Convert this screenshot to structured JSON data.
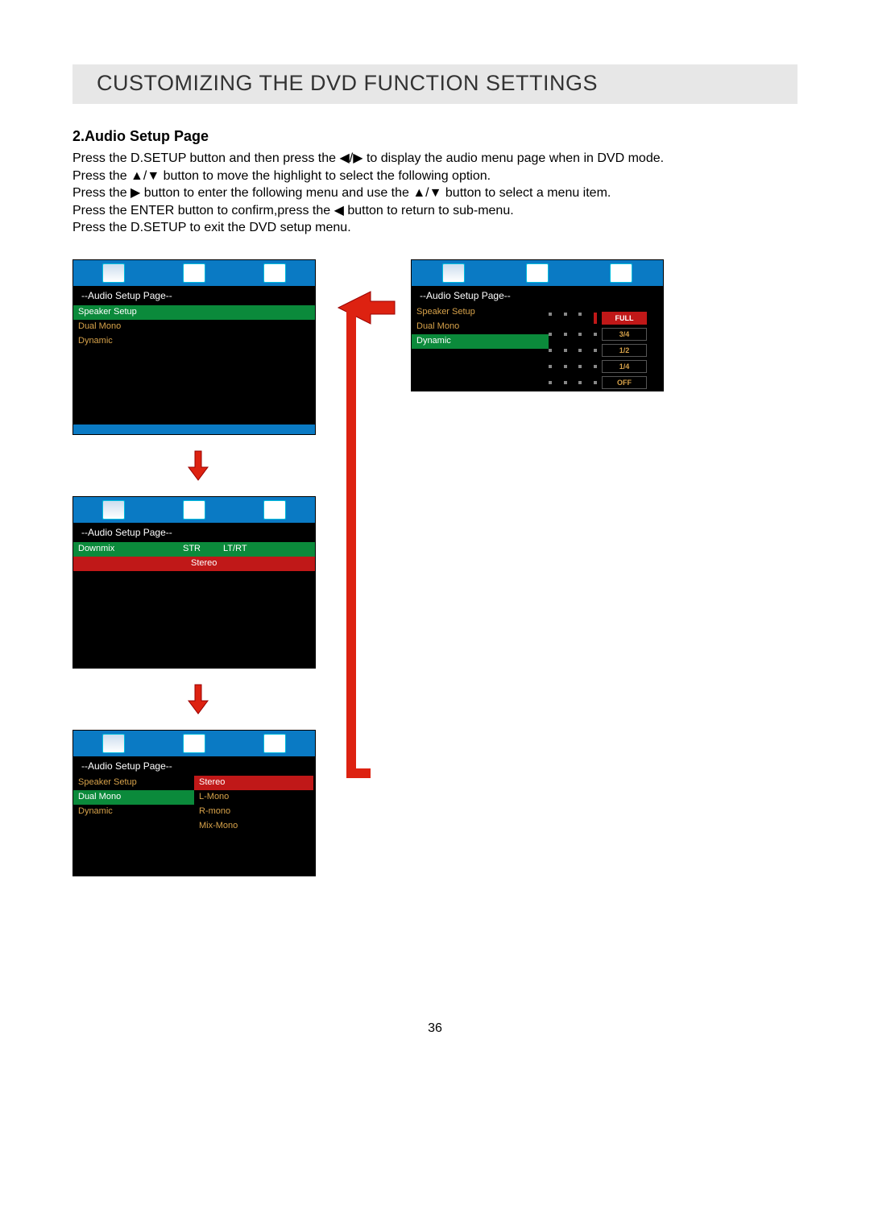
{
  "banner": "CUSTOMIZING THE DVD FUNCTION SETTINGS",
  "heading": "2.Audio Setup Page",
  "instructions": "Press the D.SETUP button and then press the ◀/▶ to display the audio menu page when in DVD mode.\nPress the ▲/▼ button to move the highlight to select the following option.\nPress the ▶ button to enter the following menu and use the ▲/▼ button to select a menu item.\nPress the ENTER button to confirm,press the ◀ button to return to sub-menu.\nPress the D.SETUP to exit the DVD setup menu.",
  "menus": {
    "page_label": "--Audio Setup Page--",
    "m1": {
      "items": [
        "Speaker  Setup",
        "Dual Mono",
        "Dynamic"
      ],
      "selected": 0
    },
    "m2": {
      "items": [
        {
          "c1": "Downmix",
          "c2": "STR",
          "c3": "LT/RT"
        }
      ],
      "sub": [
        "Stereo"
      ],
      "sub_selected": 0
    },
    "m3": {
      "items": [
        "Speaker  Setup",
        "Dual  Mono",
        "Dynamic"
      ],
      "selected": 1,
      "sub": [
        "Stereo",
        "L-Mono",
        "R-mono",
        "Mix-Mono"
      ],
      "sub_selected": 0
    },
    "m4": {
      "items": [
        "Speaker  Setup",
        "Dual  Mono",
        "Dynamic"
      ],
      "selected": 2,
      "levels": [
        "FULL",
        "3/4",
        "1/2",
        "1/4",
        "OFF"
      ],
      "level_selected": 0
    }
  },
  "page_number": "36"
}
